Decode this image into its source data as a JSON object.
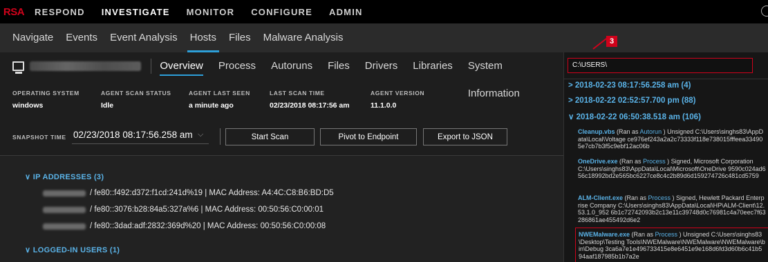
{
  "topnav": {
    "logo": "RSA",
    "items": [
      "RESPOND",
      "INVESTIGATE",
      "MONITOR",
      "CONFIGURE",
      "ADMIN"
    ],
    "active": "INVESTIGATE"
  },
  "subnav": {
    "items": [
      "Navigate",
      "Events",
      "Event Analysis",
      "Hosts",
      "Files",
      "Malware Analysis"
    ],
    "active": "Hosts"
  },
  "host": {
    "tabs": [
      "Overview",
      "Process",
      "Autoruns",
      "Files",
      "Drivers",
      "Libraries",
      "System Information"
    ],
    "active": "Overview"
  },
  "info": [
    {
      "label": "OPERATING SYSTEM",
      "value": "windows"
    },
    {
      "label": "AGENT SCAN STATUS",
      "value": "Idle"
    },
    {
      "label": "AGENT LAST SEEN",
      "value": "a minute ago"
    },
    {
      "label": "LAST SCAN TIME",
      "value": "02/23/2018 08:17:56 am"
    },
    {
      "label": "AGENT VERSION",
      "value": "11.1.0.0"
    }
  ],
  "snapshot": {
    "label": "SNAPSHOT TIME",
    "value": "02/23/2018 08:17:56.258 am",
    "chevron": "⌵"
  },
  "buttons": {
    "start_scan": "Start Scan",
    "pivot": "Pivot to Endpoint",
    "export": "Export to JSON"
  },
  "ip_section": {
    "title": "∨  IP ADDRESSES (3)",
    "rows": [
      "/ fe80::f492:d372:f1cd:241d%19  |  MAC Address: A4:4C:C8:B6:BD:D5",
      "/ fe80::3076:b28:84a5:327a%6  |  MAC Address: 00:50:56:C0:00:01",
      "/ fe80::3dad:adf:2832:369d%20  |  MAC Address: 00:50:56:C0:00:08"
    ]
  },
  "users_section": {
    "title": "∨  LOGGED-IN USERS (1)"
  },
  "search": {
    "value": "C:\\USERS\\",
    "marker": "3"
  },
  "snapshots": [
    "> 2018-02-23 08:17:56.258 am (4)",
    "> 2018-02-22 02:52:57.700 pm (88)",
    "∨ 2018-02-22 06:50:38.518 am (106)"
  ],
  "entries": [
    {
      "name": "Cleanup.vbs",
      "pre": " (Ran as ",
      "ran": "Autorun",
      "post": " )   Unsigned    C:\\Users\\singhs83\\AppData\\Local\\Voltage   ce976ef243a2a2c73333f118e738015fffeea334905e7cb7b3f5c9ebf12ac06b"
    },
    {
      "name": "OneDrive.exe",
      "pre": " (Ran as ",
      "ran": "Process",
      "post": " )   Signed, Microsoft Corporation   C:\\Users\\singhs83\\AppData\\Local\\Microsoft\\OneDrive   9590c024ad656c18992bd2e565bc6227ce8c4c2b89d6d159274726c481cd5759"
    },
    {
      "name": "ALM-Client.exe",
      "pre": " (Ran as ",
      "ran": "Process",
      "post": " )   Signed, Hewlett Packard Enterprise Company    C:\\Users\\singhs83\\AppData\\Local\\HP\\ALM-Client\\12.53.1.0_952   6b1c72742093b2c13e11c39748d0c76981c4a70eec7f63286861ae455492d6e2"
    },
    {
      "name": "NWEMalware.exe",
      "pre": " (Ran as ",
      "ran": "Process",
      "post": " )   Unsigned    C:\\Users\\singhs83\\Desktop\\Testing Tools\\NWEMalware\\NWEMalware\\NWEMalware\\bin\\Debug   3ca6a7e1e496733415e8e6451e9e168d6fd3d60b6c41b594aaf187985b1b7a2e"
    }
  ]
}
